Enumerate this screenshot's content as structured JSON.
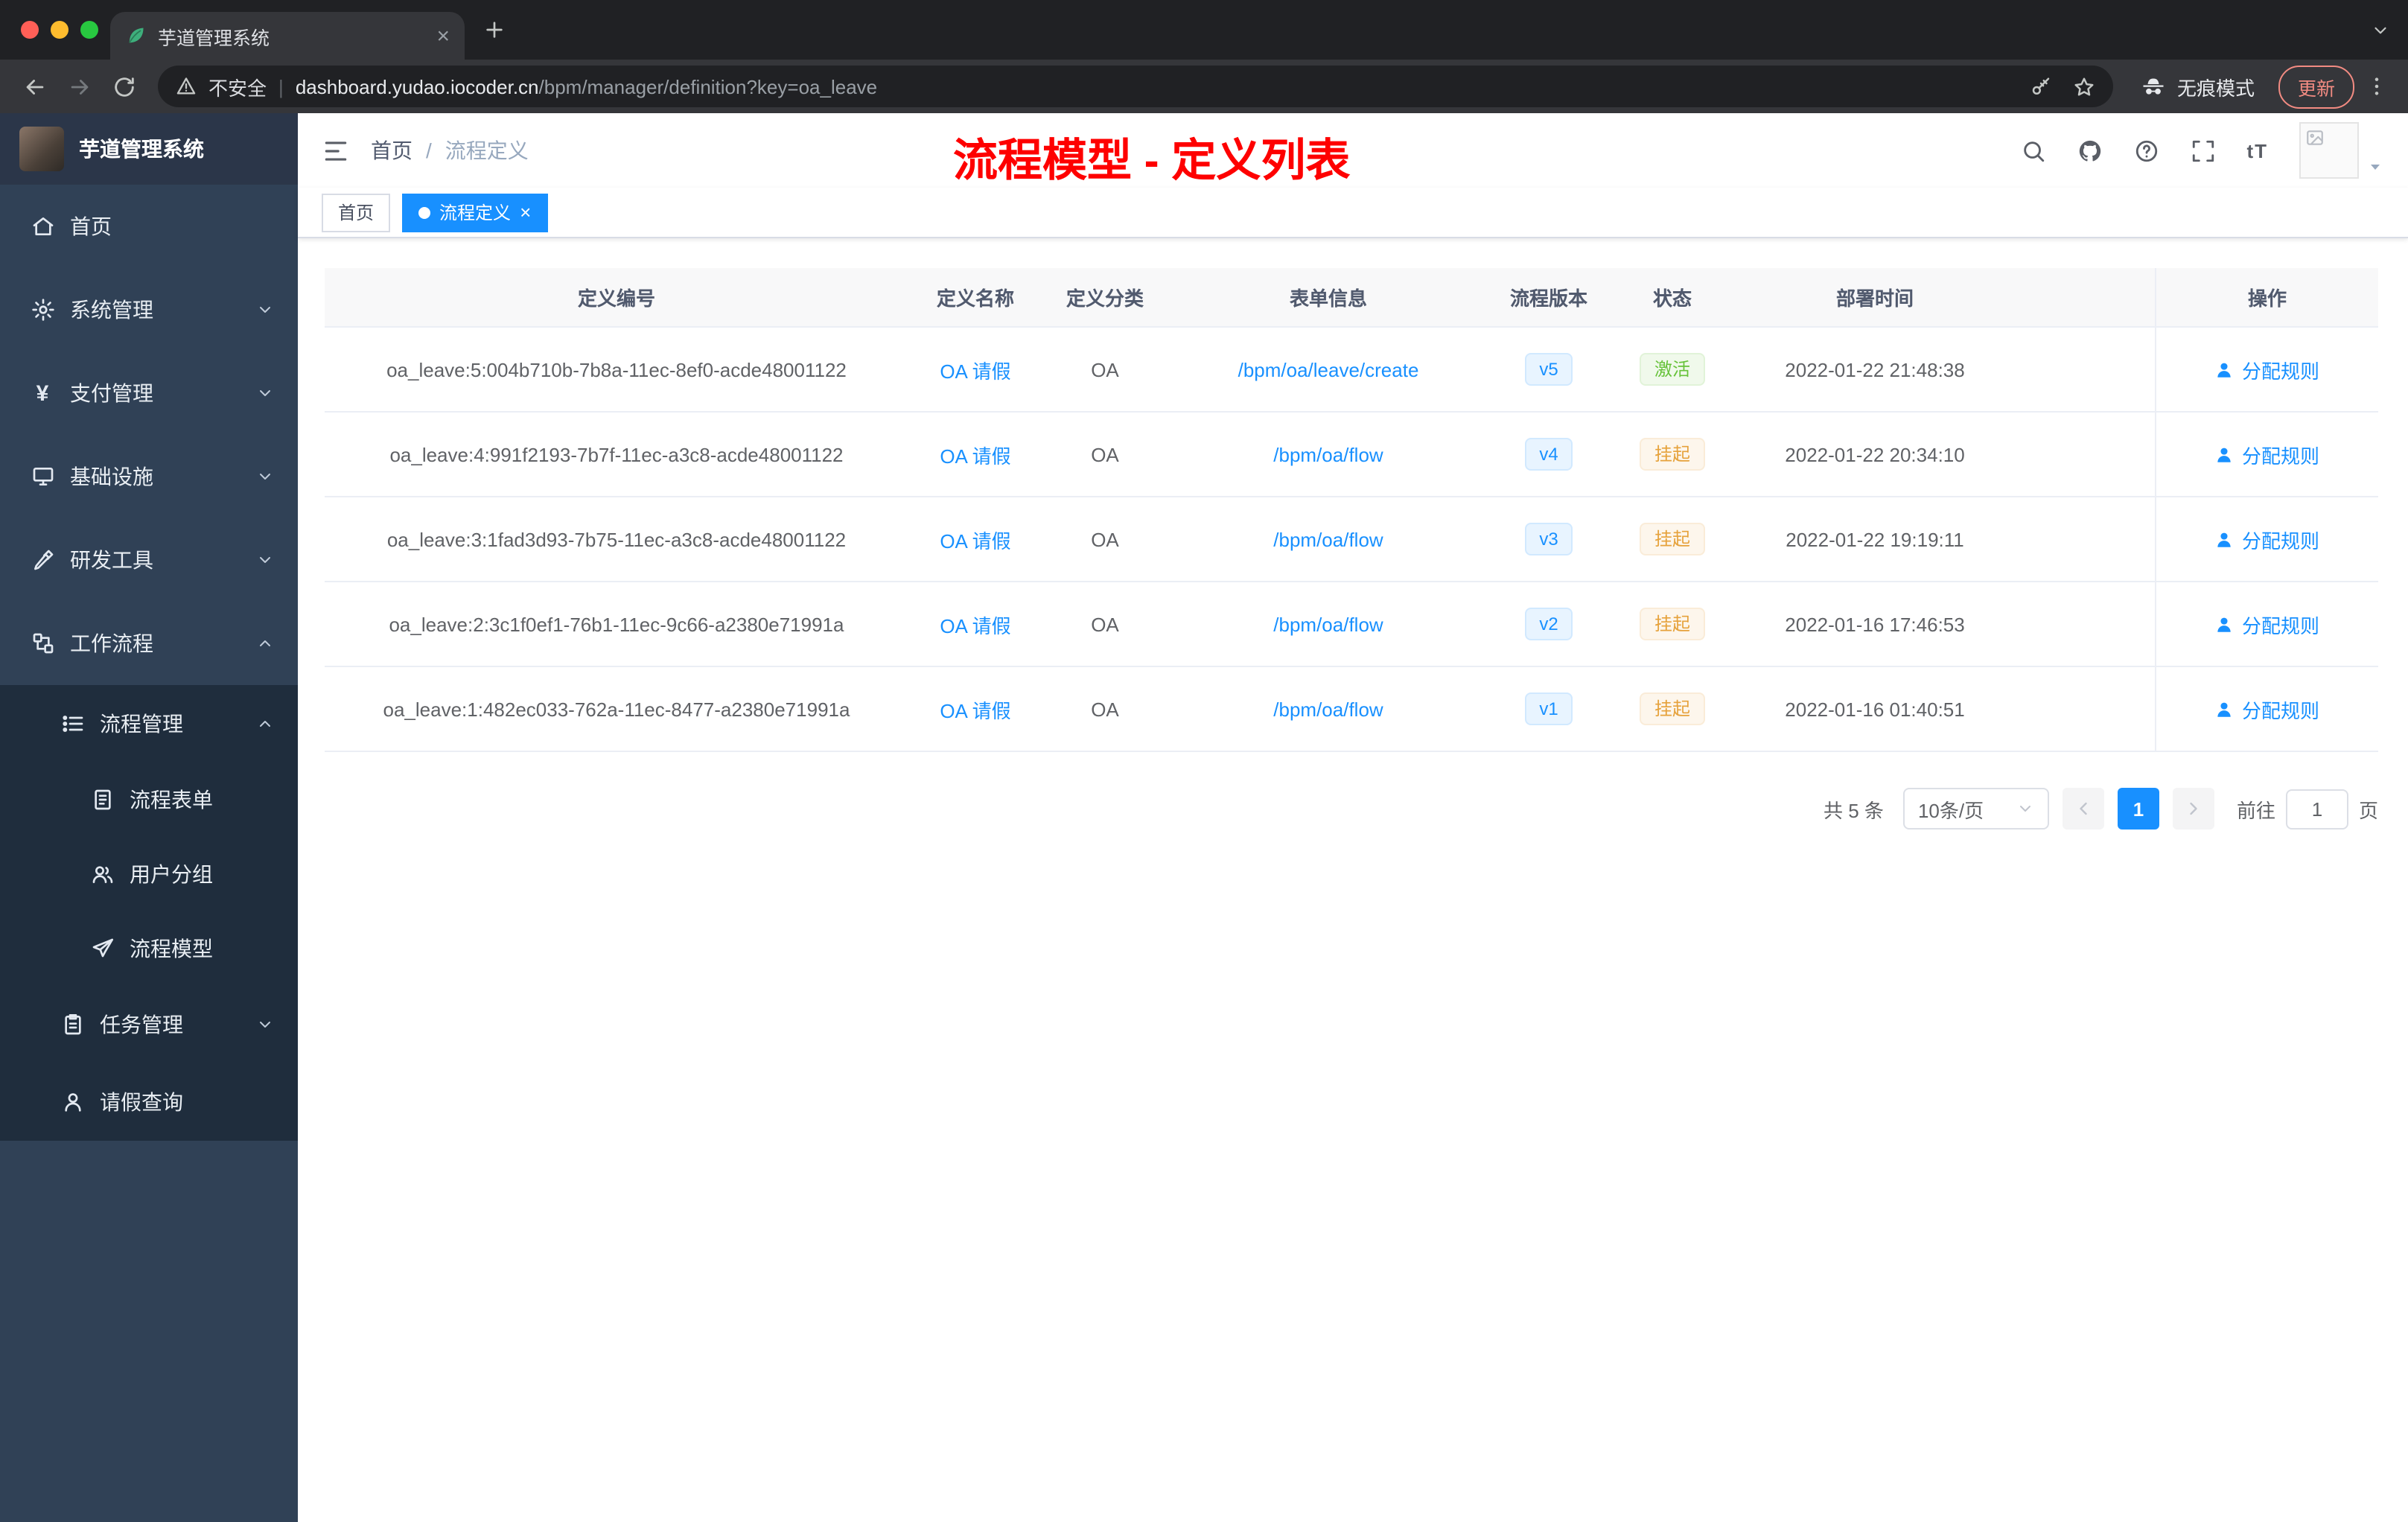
{
  "browser": {
    "tab": {
      "title": "芋道管理系统",
      "favicon": "leaf-icon"
    },
    "security_label": "不安全",
    "url_host": "dashboard.yudao.iocoder.cn",
    "url_path": "/bpm/manager/definition?key=oa_leave",
    "incognito_label": "无痕模式",
    "update_label": "更新"
  },
  "sidebar": {
    "logo_title": "芋道管理系统",
    "items": [
      {
        "key": "home",
        "label": "首页",
        "icon": "dashboard-icon",
        "level": 0
      },
      {
        "key": "system-management",
        "label": "系统管理",
        "icon": "gear-icon",
        "level": 0,
        "chevron": "down"
      },
      {
        "key": "payment-management",
        "label": "支付管理",
        "icon": "yen-icon",
        "level": 0,
        "chevron": "down"
      },
      {
        "key": "infrastructure",
        "label": "基础设施",
        "icon": "infrastructure-icon",
        "level": 0,
        "chevron": "down"
      },
      {
        "key": "dev-tools",
        "label": "研发工具",
        "icon": "tools-icon",
        "level": 0,
        "chevron": "down"
      },
      {
        "key": "workflow",
        "label": "工作流程",
        "icon": "workflow-icon",
        "level": 0,
        "chevron": "up"
      },
      {
        "key": "process-management",
        "label": "流程管理",
        "icon": "process-icon",
        "level": 1,
        "chevron": "up"
      },
      {
        "key": "process-form",
        "label": "流程表单",
        "icon": "form-icon",
        "level": 2
      },
      {
        "key": "user-group",
        "label": "用户分组",
        "icon": "user-group-icon",
        "level": 2
      },
      {
        "key": "process-model",
        "label": "流程模型",
        "icon": "model-icon",
        "level": 2
      },
      {
        "key": "task-management",
        "label": "任务管理",
        "icon": "task-icon",
        "level": 1,
        "chevron": "down"
      },
      {
        "key": "leave-query",
        "label": "请假查询",
        "icon": "person-icon",
        "level": 1
      }
    ]
  },
  "header": {
    "breadcrumb": [
      "首页",
      "流程定义"
    ],
    "annotation": "流程模型 - 定义列表",
    "action_icons": [
      "search-icon",
      "github-icon",
      "question-icon",
      "fullscreen-icon",
      "fontsize-icon"
    ]
  },
  "tags": [
    {
      "key": "home",
      "label": "首页",
      "active": false,
      "closable": false
    },
    {
      "key": "process-definition",
      "label": "流程定义",
      "active": true,
      "closable": true
    }
  ],
  "table": {
    "columns": [
      "定义编号",
      "定义名称",
      "定义分类",
      "表单信息",
      "流程版本",
      "状态",
      "部署时间",
      "操作"
    ],
    "rows": [
      {
        "id": "oa_leave:5:004b710b-7b8a-11ec-8ef0-acde48001122",
        "name": "OA 请假",
        "category": "OA",
        "form": "/bpm/oa/leave/create",
        "version": "v5",
        "status": "激活",
        "status_type": "success",
        "deploy_time": "2022-01-22 21:48:38",
        "action": "分配规则"
      },
      {
        "id": "oa_leave:4:991f2193-7b7f-11ec-a3c8-acde48001122",
        "name": "OA 请假",
        "category": "OA",
        "form": "/bpm/oa/flow",
        "version": "v4",
        "status": "挂起",
        "status_type": "warning",
        "deploy_time": "2022-01-22 20:34:10",
        "action": "分配规则"
      },
      {
        "id": "oa_leave:3:1fad3d93-7b75-11ec-a3c8-acde48001122",
        "name": "OA 请假",
        "category": "OA",
        "form": "/bpm/oa/flow",
        "version": "v3",
        "status": "挂起",
        "status_type": "warning",
        "deploy_time": "2022-01-22 19:19:11",
        "action": "分配规则"
      },
      {
        "id": "oa_leave:2:3c1f0ef1-76b1-11ec-9c66-a2380e71991a",
        "name": "OA 请假",
        "category": "OA",
        "form": "/bpm/oa/flow",
        "version": "v2",
        "status": "挂起",
        "status_type": "warning",
        "deploy_time": "2022-01-16 17:46:53",
        "action": "分配规则"
      },
      {
        "id": "oa_leave:1:482ec033-762a-11ec-8477-a2380e71991a",
        "name": "OA 请假",
        "category": "OA",
        "form": "/bpm/oa/flow",
        "version": "v1",
        "status": "挂起",
        "status_type": "warning",
        "deploy_time": "2022-01-16 01:40:51",
        "action": "分配规则"
      }
    ]
  },
  "pagination": {
    "total_label": "共 5 条",
    "page_size_label": "10条/页",
    "current_page": "1",
    "goto_label": "前往",
    "goto_value": "1",
    "page_unit_label": "页"
  },
  "colors": {
    "accent": "#1890ff",
    "success": "#67c23a",
    "warning": "#e6a23c",
    "annotation_red": "#fe0000",
    "sidebar_bg": "#304156",
    "submenu_bg": "#1f2d3d",
    "chrome_frame": "#202124",
    "chrome_toolbar": "#35363a"
  }
}
